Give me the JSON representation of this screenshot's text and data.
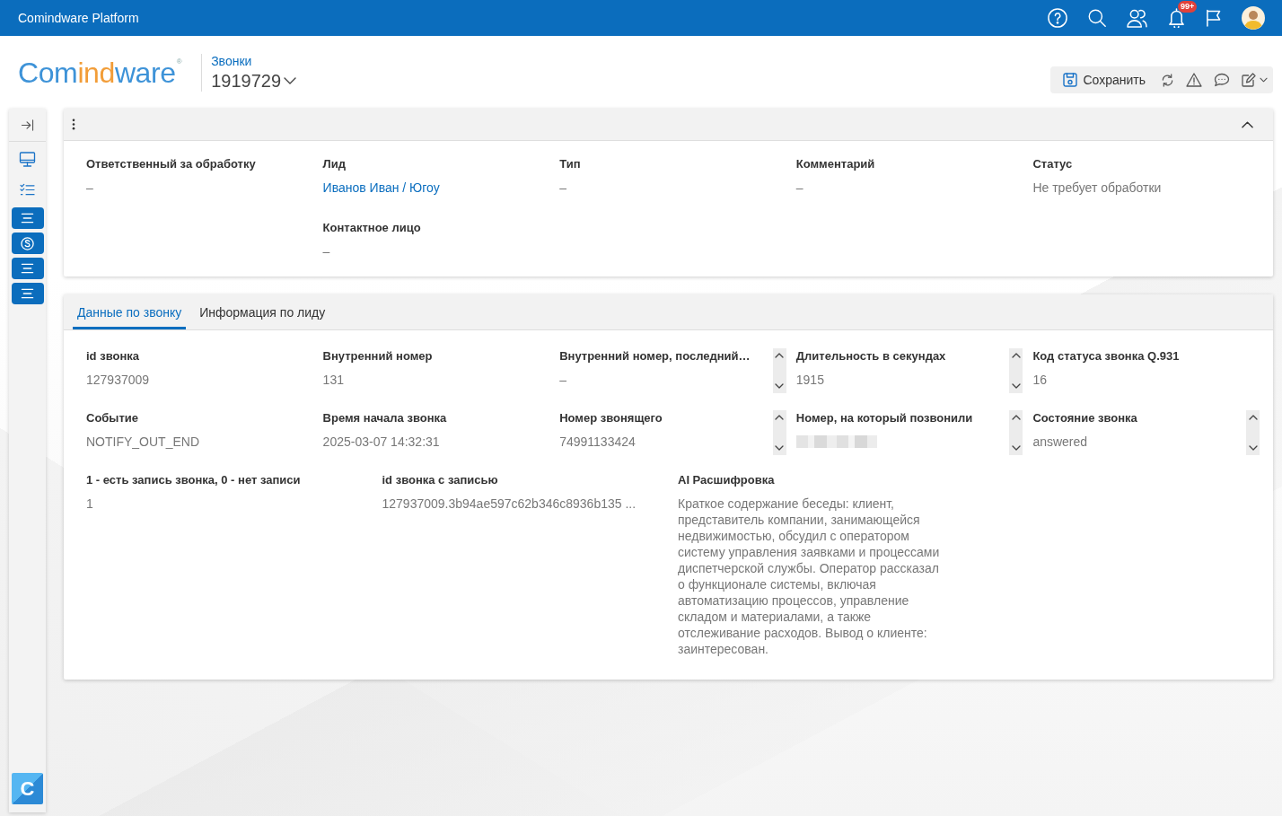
{
  "topbar": {
    "title": "Comindware Platform",
    "notification_count": "99+"
  },
  "header": {
    "logo": {
      "parts": [
        {
          "text": "Com",
          "color": "#3e93d8"
        },
        {
          "text": "ind",
          "color": "#f29d38"
        },
        {
          "text": "ware",
          "color": "#3e93d8"
        }
      ],
      "mark": "®"
    },
    "breadcrumb": "Звонки",
    "record": "1919729",
    "save_label": "Сохранить"
  },
  "sidebar": {
    "app_badge": "C"
  },
  "summary_panel": {
    "expanded": true,
    "columns": [
      [
        {
          "label": "Ответственный за обработку",
          "value": "–",
          "kind": "text"
        }
      ],
      [
        {
          "label": "Лид",
          "value": "Иванов Иван / Югоу",
          "kind": "link"
        },
        {
          "label": "Контактное лицо",
          "value": "–",
          "kind": "text"
        }
      ],
      [
        {
          "label": "Тип",
          "value": "–",
          "kind": "text"
        }
      ],
      [
        {
          "label": "Комментарий",
          "value": "–",
          "kind": "text"
        }
      ],
      [
        {
          "label": "Статус",
          "value": "Не требует обработки",
          "kind": "text"
        }
      ]
    ]
  },
  "call_panel": {
    "tabs": [
      {
        "label": "Данные по звонку",
        "selected": true
      },
      {
        "label": "Информация по лиду",
        "selected": false
      }
    ],
    "rows": [
      [
        {
          "label": "id звонка",
          "value": "127937009",
          "kind": "text",
          "scrollbar": false
        },
        {
          "label": "Внутренний номер",
          "value": "131",
          "kind": "text",
          "scrollbar": false
        },
        {
          "label": "Внутренний номер, последний…",
          "value": "–",
          "kind": "text",
          "scrollbar": true
        },
        {
          "label": "Длительность в секундах",
          "value": "1915",
          "kind": "text",
          "scrollbar": true
        },
        {
          "label": "Код статуса звонка Q.931",
          "value": "16",
          "kind": "text",
          "scrollbar": false
        }
      ],
      [
        {
          "label": "Событие",
          "value": "NOTIFY_OUT_END",
          "kind": "text",
          "scrollbar": false
        },
        {
          "label": "Время начала звонка",
          "value": "2025-03-07 14:32:31",
          "kind": "text",
          "scrollbar": false
        },
        {
          "label": "Номер звонящего",
          "value": "74991133424",
          "kind": "text",
          "scrollbar": true
        },
        {
          "label": "Номер, на который позвонили",
          "kind": "redacted",
          "scrollbar": true
        },
        {
          "label": "Состояние звонка",
          "value": "answered",
          "kind": "text",
          "scrollbar": true
        }
      ],
      [
        {
          "label": "1 - есть запись звонка, 0 - нет записи",
          "value": "1",
          "kind": "text",
          "scrollbar": false
        },
        {
          "label": "id звонка с записью",
          "value": "127937009.3b94ae597c62b346c8936b135 ...",
          "kind": "text",
          "scrollbar": false
        },
        {
          "label": "AI Расшифровка",
          "value": "Краткое содержание беседы: клиент, представитель компании, занимающейся недвижимостью, обсудил с оператором систему управления заявками и процессами диспетчерской службы. Оператор рассказал о функционале системы, включая автоматизацию процессов, управление складом и материалами, а также отслеживание расходов. Вывод о клиенте: заинтересован.",
          "kind": "text",
          "scrollbar": false
        }
      ]
    ]
  }
}
